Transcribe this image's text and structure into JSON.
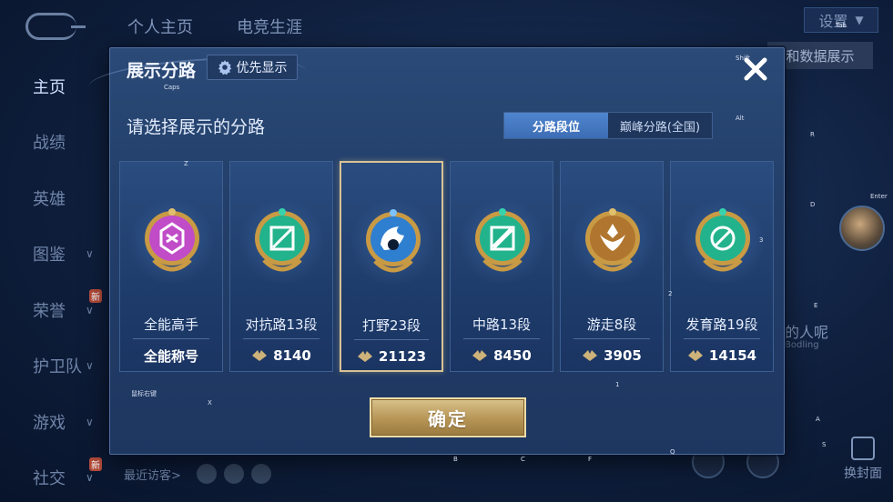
{
  "background": {
    "tabs": [
      "个人主页",
      "电竞生涯"
    ],
    "settings_label": "设置",
    "data_button": "和数据展示",
    "side_nav": [
      {
        "label": "主页",
        "active": true
      },
      {
        "label": "战绩"
      },
      {
        "label": "英雄"
      },
      {
        "label": "图鉴",
        "chevron": true
      },
      {
        "label": "荣誉",
        "chevron": true,
        "badge": "新"
      },
      {
        "label": "护卫队",
        "chevron": true
      },
      {
        "label": "游戏",
        "chevron": true
      },
      {
        "label": "社交",
        "chevron": true,
        "badge": "新"
      }
    ],
    "recent_visitors": "最近访客>",
    "right_text": "的人呢",
    "right_subtext": "Bodling",
    "cover_label": "换封面"
  },
  "dialog": {
    "title": "展示分路",
    "priority_label": "优先显示",
    "subtitle": "请选择展示的分路",
    "toggle": [
      "分路段位",
      "巅峰分路(全国)"
    ],
    "active_toggle": 0,
    "cards": [
      {
        "name": "全能高手",
        "value": "全能称号",
        "emblem": "all-round-emblem-icon",
        "color": "#c04cc8",
        "show_icon": false
      },
      {
        "name": "对抗路13段",
        "value": "8140",
        "emblem": "clash-lane-emblem-icon",
        "color": "#22b38c",
        "show_icon": true
      },
      {
        "name": "打野23段",
        "value": "21123",
        "emblem": "jungle-emblem-icon",
        "color": "#2f7fd0",
        "show_icon": true,
        "selected": true
      },
      {
        "name": "中路13段",
        "value": "8450",
        "emblem": "mid-lane-emblem-icon",
        "color": "#22b38c",
        "show_icon": true
      },
      {
        "name": "游走8段",
        "value": "3905",
        "emblem": "roam-emblem-icon",
        "color": "#b0762f",
        "show_icon": true
      },
      {
        "name": "发育路19段",
        "value": "14154",
        "emblem": "farm-lane-emblem-icon",
        "color": "#22b38c",
        "show_icon": true
      }
    ],
    "confirm_label": "确定"
  },
  "key_hints": [
    {
      "text": "Caps"
    },
    {
      "text": "Z"
    },
    {
      "text": "Shift"
    },
    {
      "text": "Alt"
    },
    {
      "text": "R"
    },
    {
      "text": "Tab"
    },
    {
      "text": "D"
    },
    {
      "text": "Enter"
    },
    {
      "text": "3"
    },
    {
      "text": "2"
    },
    {
      "text": "E"
    },
    {
      "text": "1"
    },
    {
      "text": "X"
    },
    {
      "text": "A"
    },
    {
      "text": "S"
    },
    {
      "text": "B"
    },
    {
      "text": "C"
    },
    {
      "text": "F"
    },
    {
      "text": "Q"
    },
    {
      "text": "鼠标右键"
    }
  ]
}
